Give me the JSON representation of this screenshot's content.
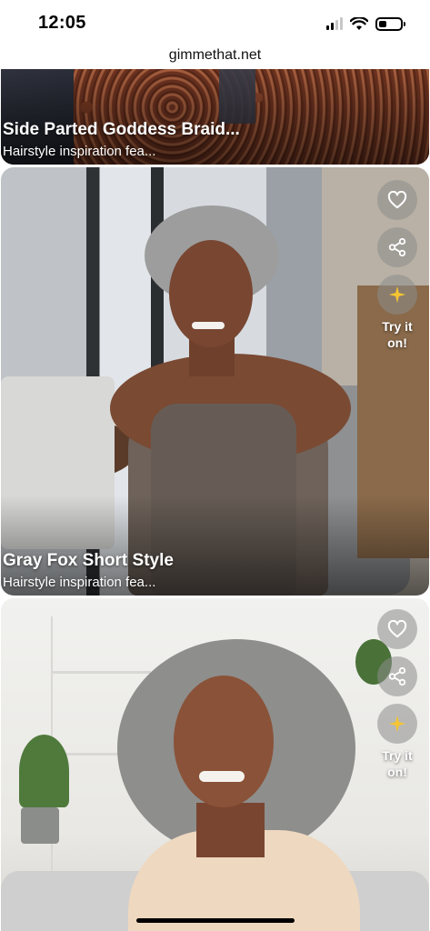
{
  "status_bar": {
    "time": "12:05"
  },
  "browser": {
    "url": "gimmethat.net"
  },
  "cards": [
    {
      "title": "Side Parted Goddess Braid...",
      "subtitle": "Hairstyle inspiration fea..."
    },
    {
      "title": "Gray Fox Short Style",
      "subtitle": "Hairstyle inspiration fea...",
      "try_label": "Try it on!"
    },
    {
      "try_label": "Try it on!"
    }
  ],
  "icons": {
    "like": "heart-icon",
    "share": "share-icon",
    "try_on": "sparkle-icon"
  },
  "colors": {
    "sparkle": "#f5c531",
    "button_bg": "#8c8c8c"
  }
}
